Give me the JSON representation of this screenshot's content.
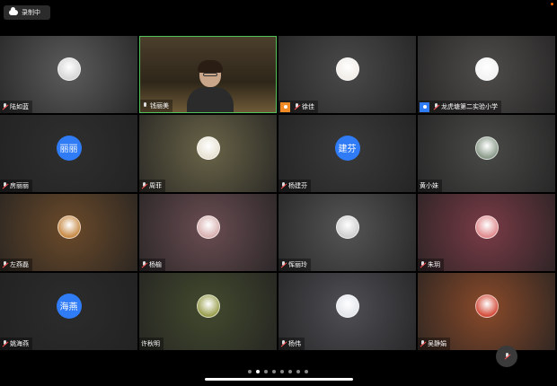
{
  "recording": {
    "label": "录制中",
    "accent": "#ff6a00"
  },
  "participants": [
    {
      "name": "陆如蓝",
      "mic": "off",
      "kind": "photo",
      "bg": "#5c5c5c",
      "avatar": "#d7d7d7"
    },
    {
      "name": "钱丽美",
      "mic": "on",
      "kind": "video",
      "bg": "#3b3326",
      "active": true
    },
    {
      "name": "徐佳",
      "mic": "off",
      "kind": "photo",
      "bg": "#4a4a4a",
      "avatar": "#f1ede8",
      "badge": "host"
    },
    {
      "name": "龙虎塘第二实验小学",
      "mic": "off",
      "kind": "photo",
      "bg": "#4f4d4b",
      "avatar": "#f3f3f3",
      "badge": "cohost"
    },
    {
      "name": "房丽丽",
      "mic": "off",
      "kind": "text",
      "text": "丽丽",
      "bg": "#2f2f2f"
    },
    {
      "name": "周菲",
      "mic": "off",
      "kind": "photo",
      "bg": "#6a6448",
      "avatar": "#e7e2d3"
    },
    {
      "name": "杨建芬",
      "mic": "off",
      "kind": "text",
      "text": "建芬",
      "bg": "#3a3a3a"
    },
    {
      "name": "黄小妹",
      "mic": "none",
      "kind": "photo",
      "bg": "#4a4a48",
      "avatar": "#8b9b8a"
    },
    {
      "name": "左燕磊",
      "mic": "off",
      "kind": "photo",
      "bg": "#6b4a2a",
      "avatar": "#c78a45"
    },
    {
      "name": "杨榆",
      "mic": "off",
      "kind": "photo",
      "bg": "#6a4d52",
      "avatar": "#d8b0b0"
    },
    {
      "name": "恽丽玲",
      "mic": "off",
      "kind": "photo",
      "bg": "#555555",
      "avatar": "#cfcfcf"
    },
    {
      "name": "朱玥",
      "mic": "off",
      "kind": "photo",
      "bg": "#7a3b46",
      "avatar": "#e08b8e"
    },
    {
      "name": "姚海燕",
      "mic": "off",
      "kind": "text",
      "text": "海燕",
      "bg": "#2c2c2c"
    },
    {
      "name": "许秋明",
      "mic": "none",
      "kind": "photo",
      "bg": "#434a2e",
      "avatar": "#9a9f4e"
    },
    {
      "name": "杨伟",
      "mic": "off",
      "kind": "photo",
      "bg": "#4f4f55",
      "avatar": "#e3e6ea"
    },
    {
      "name": "吴静娟",
      "mic": "off",
      "kind": "photo",
      "bg": "#8a4a2a",
      "avatar": "#d44d3b"
    }
  ],
  "pager": {
    "total": 8,
    "current": 2
  },
  "colors": {
    "active_border": "#52c15a",
    "text_avatar": "#2f7cf6"
  }
}
